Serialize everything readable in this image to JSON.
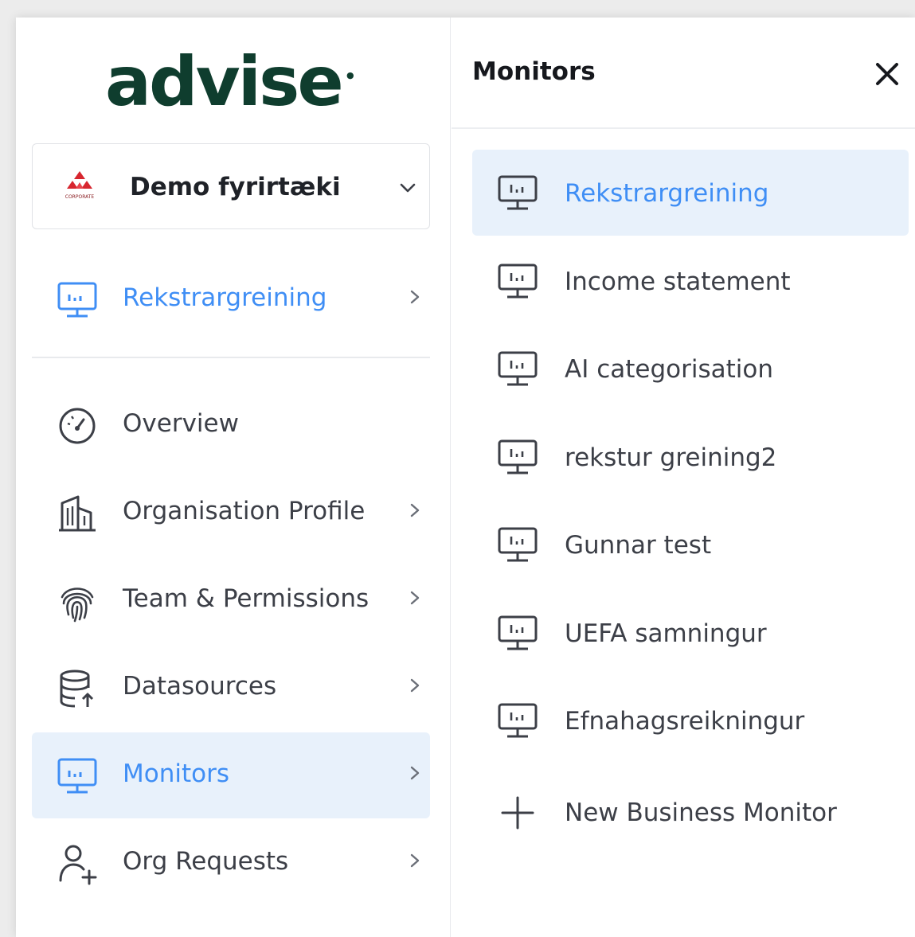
{
  "brand": {
    "logo_text": "advise"
  },
  "colors": {
    "brand_green": "#0f3d2e",
    "accent_blue": "#3f8ef5",
    "active_bg": "#e8f1fb"
  },
  "org": {
    "name": "Demo fyrirtæki",
    "logo_caption": "CORPORATE"
  },
  "current_monitor": {
    "label": "Rekstrargreining",
    "icon": "monitor-chart-icon"
  },
  "nav": {
    "items": [
      {
        "label": "Overview",
        "icon": "speedometer-icon"
      },
      {
        "label": "Organisation Profile",
        "icon": "building-icon"
      },
      {
        "label": "Team & Permissions",
        "icon": "fingerprint-icon"
      },
      {
        "label": "Datasources",
        "icon": "database-upload-icon"
      },
      {
        "label": "Monitors",
        "icon": "monitor-chart-icon",
        "active": true
      },
      {
        "label": "Org Requests",
        "icon": "user-add-icon"
      }
    ]
  },
  "panel": {
    "title": "Monitors",
    "monitors": [
      {
        "label": "Rekstrargreining",
        "active": true
      },
      {
        "label": "Income statement"
      },
      {
        "label": "AI categorisation"
      },
      {
        "label": "rekstur greining2"
      },
      {
        "label": "Gunnar test"
      },
      {
        "label": "UEFA samningur"
      },
      {
        "label": "Efnahagsreikningur"
      }
    ],
    "new_label": "New Business Monitor"
  }
}
